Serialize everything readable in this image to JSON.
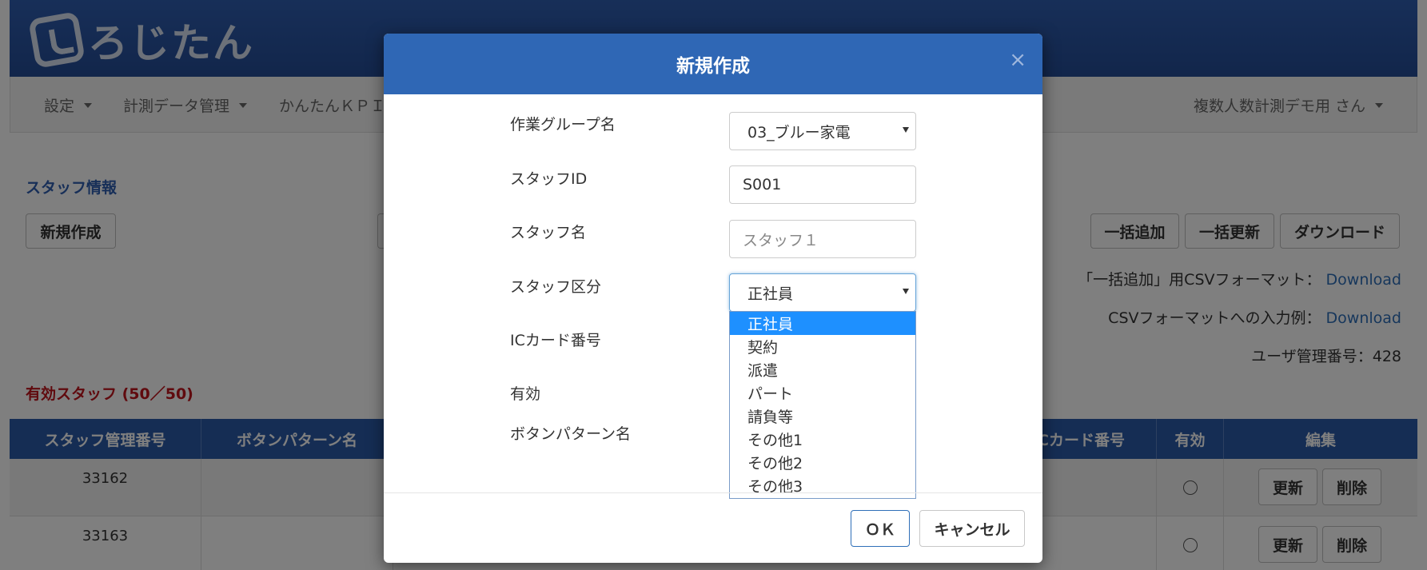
{
  "brand": {
    "logo_text": "ろじたん"
  },
  "nav": {
    "settings": "設定",
    "data_management": "計測データ管理",
    "kpi": "かんたんＫＰＩ",
    "user": "複数人数計測デモ用 さん"
  },
  "page": {
    "section_title": "スタッフ情報",
    "new_button": "新規作成",
    "bulk_add": "一括追加",
    "bulk_update": "一括更新",
    "download": "ダウンロード",
    "csv_format_label": "「一括追加」用CSVフォーマット：",
    "csv_format_link": "Download",
    "csv_example_label": "CSVフォーマットへの入力例：",
    "csv_example_link": "Download",
    "user_number": "ユーザ管理番号：428",
    "valid_staff": "有効スタッフ (50／50)"
  },
  "table": {
    "headers": {
      "staff_no": "スタッフ管理番号",
      "button_pattern": "ボタンパターン名",
      "ic_card": "ICカード番号",
      "valid": "有効",
      "edit": "編集"
    },
    "rows": [
      {
        "staff_no": "33162",
        "update": "更新",
        "delete": "削除"
      },
      {
        "staff_no": "33163",
        "update": "更新",
        "delete": "削除"
      }
    ]
  },
  "modal": {
    "title": "新規作成",
    "close": "×",
    "labels": {
      "work_group": "作業グループ名",
      "staff_id": "スタッフID",
      "staff_name": "スタッフ名",
      "staff_type": "スタッフ区分",
      "ic_card": "ICカード番号",
      "valid": "有効",
      "button_pattern": "ボタンパターン名"
    },
    "values": {
      "work_group": "03_ブルー家電",
      "staff_id": "S001",
      "staff_name_placeholder": "スタッフ１",
      "staff_type": "正社員"
    },
    "options": [
      "正社員",
      "契約",
      "派遣",
      "パート",
      "請負等",
      "その他1",
      "その他2",
      "その他3"
    ],
    "ok": "ＯＫ",
    "cancel": "キャンセル"
  }
}
